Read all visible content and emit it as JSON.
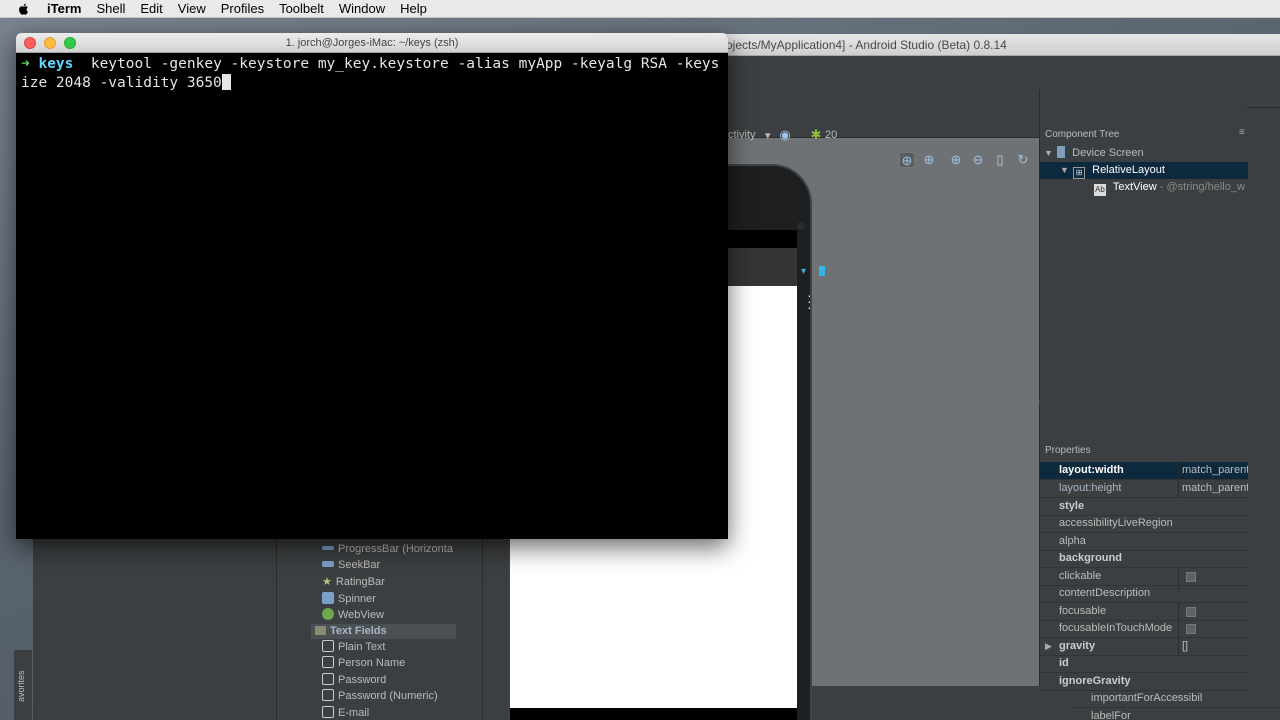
{
  "menubar": {
    "app": "iTerm",
    "items": [
      "Shell",
      "Edit",
      "View",
      "Profiles",
      "Toolbelt",
      "Window",
      "Help"
    ]
  },
  "android_studio": {
    "title": "ojects/MyApplication4] - Android Studio (Beta) 0.8.14",
    "designer_toolbar": {
      "activity": "ctivity",
      "api_level": "20"
    },
    "component_tree": {
      "header": "Component Tree",
      "items": [
        {
          "label": "Device Screen"
        },
        {
          "label": "RelativeLayout"
        },
        {
          "label": "TextView",
          "detail": " - @string/hello_w"
        }
      ]
    },
    "properties": {
      "header": "Properties",
      "rows": [
        {
          "name": "layout:width",
          "value": "match_parent"
        },
        {
          "name": "layout:height",
          "value": "match_parent"
        },
        {
          "name": "style",
          "value": ""
        },
        {
          "name": "accessibilityLiveRegion",
          "value": ""
        },
        {
          "name": "alpha",
          "value": ""
        },
        {
          "name": "background",
          "value": ""
        },
        {
          "name": "clickable",
          "value": ""
        },
        {
          "name": "contentDescription",
          "value": ""
        },
        {
          "name": "focusable",
          "value": ""
        },
        {
          "name": "focusableInTouchMode",
          "value": ""
        },
        {
          "name": "gravity",
          "value": "[]"
        },
        {
          "name": "id",
          "value": ""
        },
        {
          "name": "ignoreGravity",
          "value": ""
        },
        {
          "name": "importantForAccessibil",
          "value": ""
        },
        {
          "name": "labelFor",
          "value": ""
        }
      ]
    },
    "palette": {
      "items": [
        "ProgressBar (Horizonta",
        "SeekBar",
        "RatingBar",
        "Spinner",
        "WebView"
      ],
      "section": "Text Fields",
      "text_fields": [
        "Plain Text",
        "Person Name",
        "Password",
        "Password (Numeric)",
        "E-mail"
      ]
    },
    "favorites": "avorites"
  },
  "iterm": {
    "title": "1. jorch@Jorges-iMac: ~/keys (zsh)",
    "prompt_arrow": "➜",
    "prompt_dir": "keys",
    "command": "  keytool -genkey -keystore my_key.keystore -alias myApp -keyalg RSA -keysize 2048 -validity 3650"
  },
  "colors": {
    "terminal_bg": "#000000",
    "prompt_arrow": "#5fd75f",
    "prompt_dir": "#5fd7ff",
    "ide_bg": "#3c3f41",
    "selection": "#0d293e"
  }
}
